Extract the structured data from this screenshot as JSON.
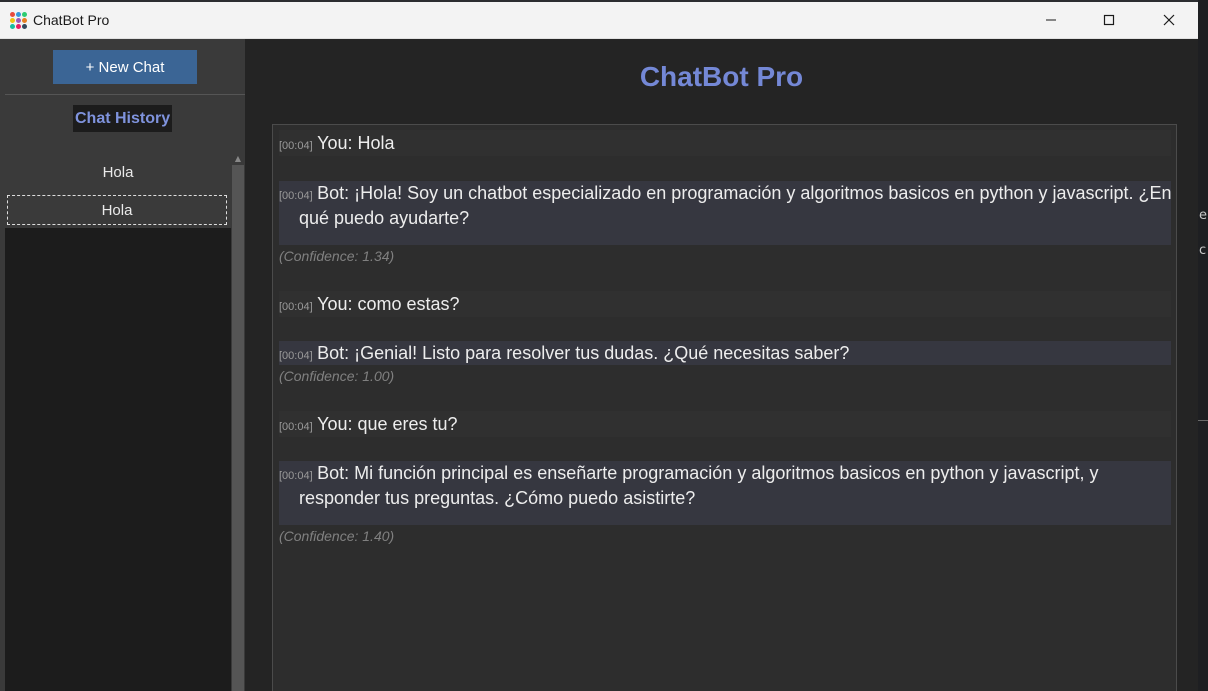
{
  "window": {
    "title": "ChatBot Pro"
  },
  "sidebar": {
    "new_chat_label": "+ New Chat",
    "history_title": "Chat History",
    "items": [
      {
        "label": "Hola"
      },
      {
        "label": "Hola"
      }
    ]
  },
  "main": {
    "title": "ChatBot Pro",
    "messages": [
      {
        "time": "[00:04]",
        "text": "You: Hola"
      },
      {
        "time": "[00:04]",
        "text": "Bot: ¡Hola! Soy un chatbot especializado en programación y algoritmos basicos en python y javascript. ¿En",
        "text_cont": "qué puedo ayudarte?",
        "confidence": "(Confidence: 1.34)"
      },
      {
        "time": "[00:04]",
        "text": "You: como estas?"
      },
      {
        "time": "[00:04]",
        "text": "Bot: ¡Genial! Listo para resolver tus dudas. ¿Qué necesitas saber?",
        "confidence": "(Confidence: 1.00)"
      },
      {
        "time": "[00:04]",
        "text": "You: que eres tu?"
      },
      {
        "time": "[00:04]",
        "text": "Bot: Mi función principal es enseñarte programación y algoritmos basicos en python y javascript, y",
        "text_cont": "responder tus preguntas. ¿Cómo puedo asistirte?",
        "confidence": "(Confidence: 1.40)"
      }
    ]
  },
  "colors": {
    "accent_title": "#7488d6",
    "new_chat_button": "#3b6595",
    "message_highlight": "#363740"
  },
  "icons": [
    "app-icon",
    "minimize-icon",
    "maximize-icon",
    "close-icon",
    "scroll-up-icon"
  ]
}
